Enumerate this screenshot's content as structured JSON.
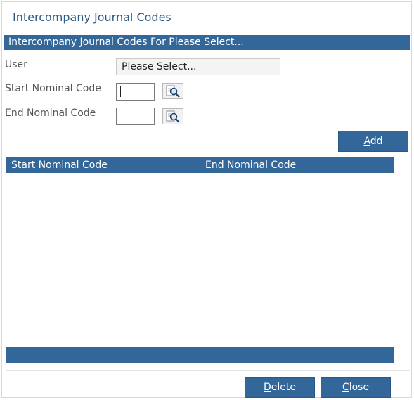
{
  "dialog": {
    "title": "Intercompany Journal Codes",
    "section_header": "Intercompany Journal Codes For Please Select..."
  },
  "form": {
    "user_label": "User",
    "user_value": "Please Select...",
    "start_label": "Start Nominal Code",
    "start_value": "",
    "end_label": "End Nominal Code",
    "end_value": "",
    "add_button": {
      "accel": "A",
      "rest": "dd"
    }
  },
  "grid": {
    "columns": [
      "Start Nominal Code",
      "End Nominal Code"
    ],
    "rows": []
  },
  "footer": {
    "delete_button": {
      "accel": "D",
      "rest": "elete"
    },
    "close_button": {
      "accel": "C",
      "rest": "lose"
    }
  },
  "colors": {
    "accent": "#336699",
    "title": "#2e5a86"
  },
  "icons": [
    "lookup-magnifier-icon"
  ]
}
